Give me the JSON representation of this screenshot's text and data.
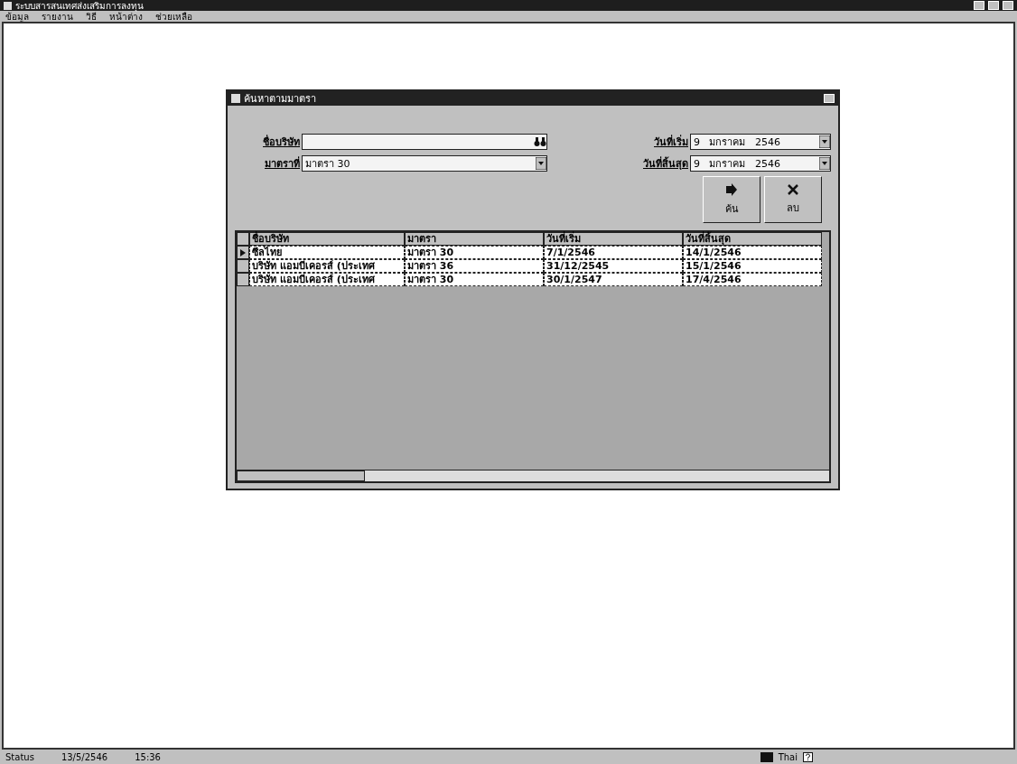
{
  "window": {
    "title": "ระบบสารสนเทศส่งเสริมการลงทุน"
  },
  "menu": [
    "ข้อมูล",
    "รายงาน",
    "วิธี",
    "หน้าต่าง",
    "ช่วยเหลือ"
  ],
  "dialog": {
    "title": "ค้นหาตามมาตรา",
    "fields": [
      {
        "label": "ชื่อบริษัท",
        "kind": "search"
      },
      {
        "label": "วันที่เริ่ม",
        "value": "9   มกราคม   2546",
        "kind": "date"
      },
      {
        "label": "มาตราที่",
        "value": "มาตรา 30",
        "kind": "combo"
      },
      {
        "label": "วันที่สิ้นสุด",
        "value": "9   มกราคม   2546",
        "kind": "date"
      }
    ],
    "buttons": [
      {
        "label": "ค้น",
        "kind": "search"
      },
      {
        "label": "ลบ",
        "kind": "clear"
      }
    ],
    "table": {
      "columns": [
        "ชื่อบริษัท",
        "มาตรา",
        "วันที่เริ่ม",
        "วันที่สิ้นสุด"
      ],
      "rows": [
        {
          "selected": true,
          "cells": [
            "ซีลไทย",
            "มาตรา 30",
            "7/1/2546",
            "14/1/2546"
          ]
        },
        {
          "selected": false,
          "cells": [
            "บริษัท แอมบีเคอรส์ (ประเทศ",
            "มาตรา 36",
            "31/12/2545",
            "15/1/2546"
          ]
        },
        {
          "selected": false,
          "cells": [
            "บริษัท แอมบีเคอรส์ (ประเทศ",
            "มาตรา 30",
            "30/1/2547",
            "17/4/2546"
          ]
        }
      ]
    }
  },
  "status_bar": {
    "items": [
      "Status",
      "13/5/2546",
      "15:36"
    ],
    "language": "Thai"
  }
}
